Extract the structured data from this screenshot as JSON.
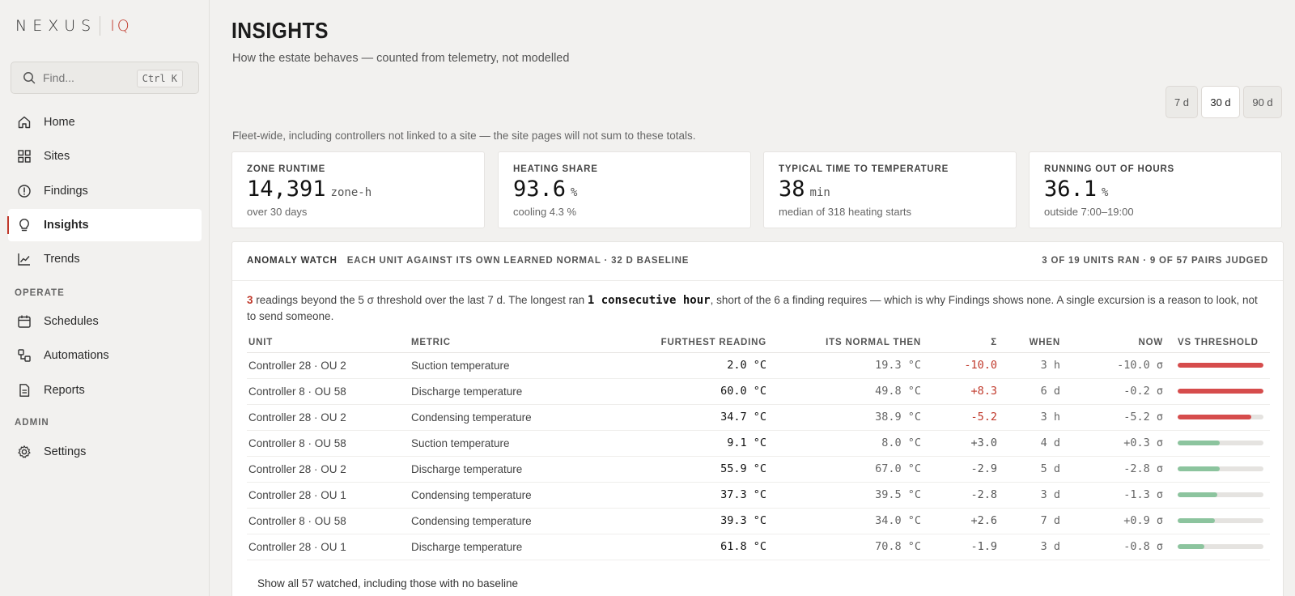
{
  "brand": {
    "word": "NEXUS",
    "suffix": "IQ"
  },
  "search": {
    "placeholder": "Find...",
    "shortcut": "Ctrl K"
  },
  "nav": {
    "home": "Home",
    "sites": "Sites",
    "findings": "Findings",
    "insights": "Insights",
    "trends": "Trends",
    "operate_label": "OPERATE",
    "schedules": "Schedules",
    "automations": "Automations",
    "reports": "Reports",
    "admin_label": "ADMIN",
    "settings": "Settings"
  },
  "header": {
    "title": "INSIGHTS",
    "subtitle": "How the estate behaves — counted from telemetry, not modelled"
  },
  "range": {
    "d7": "7 d",
    "d30": "30 d",
    "d90": "90 d",
    "selected": "30 d"
  },
  "note": "Fleet-wide, including controllers not linked to a site — the site pages will not sum to these totals.",
  "kpis": [
    {
      "label": "ZONE RUNTIME",
      "value": "14,391",
      "unit": "zone-h",
      "foot": "over 30 days"
    },
    {
      "label": "HEATING SHARE",
      "value": "93.6",
      "unit": "%",
      "foot": "cooling 4.3 %"
    },
    {
      "label": "TYPICAL TIME TO TEMPERATURE",
      "value": "38",
      "unit": "min",
      "foot": "median of 318 heating starts"
    },
    {
      "label": "RUNNING OUT OF HOURS",
      "value": "36.1",
      "unit": "%",
      "foot": "outside 7:00–19:00"
    }
  ],
  "anomaly": {
    "title": "ANOMALY WATCH",
    "subtitle": "EACH UNIT AGAINST ITS OWN LEARNED NORMAL · 32 D BASELINE",
    "right": "3 OF 19 UNITS RAN · 9 OF 57 PAIRS JUDGED",
    "summary_count": "3",
    "summary_a": " readings beyond the 5 σ threshold over the last 7 d. The longest ran ",
    "summary_long": "1 consecutive hour",
    "summary_b": ", short of the 6 a finding requires — which is why Findings shows none. A single excursion is a reason to look, not to send someone.",
    "columns": {
      "unit": "UNIT",
      "metric": "METRIC",
      "furthest": "FURTHEST READING",
      "normal": "ITS NORMAL THEN",
      "sigma": "Σ",
      "when": "WHEN",
      "now": "NOW",
      "vs": "VS THRESHOLD"
    },
    "rows": [
      {
        "unit": "Controller 28 · OU 2",
        "metric": "Suction temperature",
        "furthest": "2.0 °C",
        "normal": "19.3 °C",
        "sigma": "-10.0",
        "sigma_hot": true,
        "when": "3 h",
        "now": "-10.0 σ",
        "ratio": 1.0,
        "hot": true
      },
      {
        "unit": "Controller 8 · OU 58",
        "metric": "Discharge temperature",
        "furthest": "60.0 °C",
        "normal": "49.8 °C",
        "sigma": "+8.3",
        "sigma_hot": true,
        "when": "6 d",
        "now": "-0.2 σ",
        "ratio": 1.0,
        "hot": true
      },
      {
        "unit": "Controller 28 · OU 2",
        "metric": "Condensing temperature",
        "furthest": "34.7 °C",
        "normal": "38.9 °C",
        "sigma": "-5.2",
        "sigma_hot": true,
        "when": "3 h",
        "now": "-5.2 σ",
        "ratio": 0.86,
        "hot": true
      },
      {
        "unit": "Controller 8 · OU 58",
        "metric": "Suction temperature",
        "furthest": "9.1 °C",
        "normal": "8.0 °C",
        "sigma": "+3.0",
        "sigma_hot": false,
        "when": "4 d",
        "now": "+0.3 σ",
        "ratio": 0.49,
        "hot": false
      },
      {
        "unit": "Controller 28 · OU 2",
        "metric": "Discharge temperature",
        "furthest": "55.9 °C",
        "normal": "67.0 °C",
        "sigma": "-2.9",
        "sigma_hot": false,
        "when": "5 d",
        "now": "-2.8 σ",
        "ratio": 0.49,
        "hot": false
      },
      {
        "unit": "Controller 28 · OU 1",
        "metric": "Condensing temperature",
        "furthest": "37.3 °C",
        "normal": "39.5 °C",
        "sigma": "-2.8",
        "sigma_hot": false,
        "when": "3 d",
        "now": "-1.3 σ",
        "ratio": 0.46,
        "hot": false
      },
      {
        "unit": "Controller 8 · OU 58",
        "metric": "Condensing temperature",
        "furthest": "39.3 °C",
        "normal": "34.0 °C",
        "sigma": "+2.6",
        "sigma_hot": false,
        "when": "7 d",
        "now": "+0.9 σ",
        "ratio": 0.43,
        "hot": false
      },
      {
        "unit": "Controller 28 · OU 1",
        "metric": "Discharge temperature",
        "furthest": "61.8 °C",
        "normal": "70.8 °C",
        "sigma": "-1.9",
        "sigma_hot": false,
        "when": "3 d",
        "now": "-0.8 σ",
        "ratio": 0.31,
        "hot": false
      }
    ],
    "show_all": "Show all 57 watched, including those with no baseline"
  },
  "colors": {
    "accent": "#c0392b",
    "hot_bar": "#d64c4c",
    "ok_bar": "#8cc49e"
  }
}
